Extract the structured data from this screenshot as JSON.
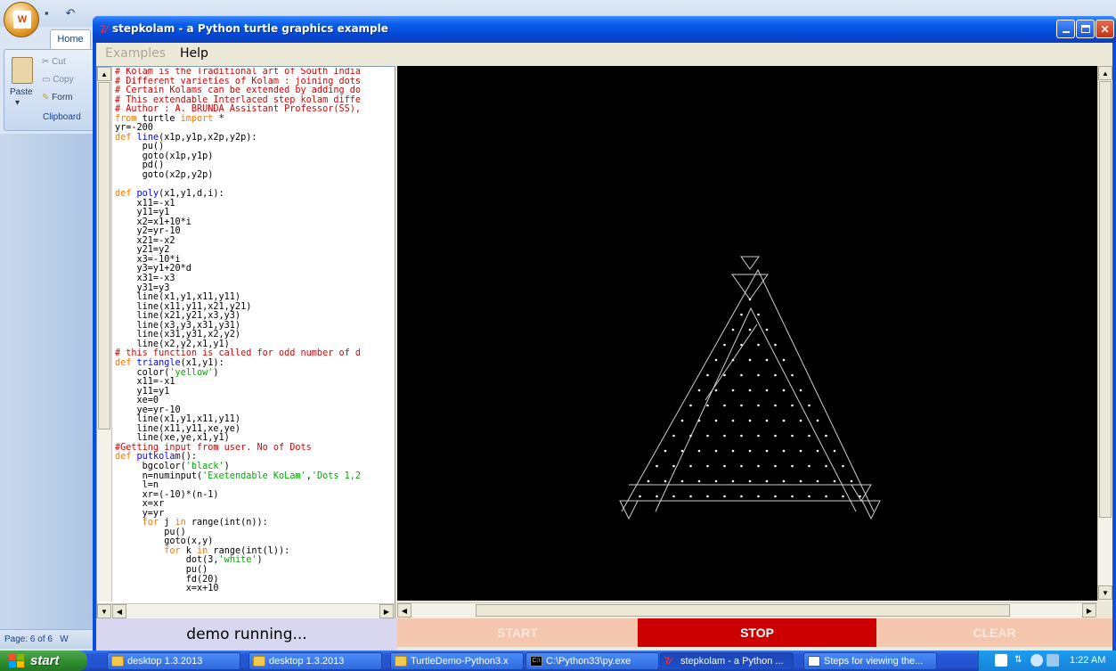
{
  "word": {
    "home_tab": "Home",
    "cut": "Cut",
    "copy": "Copy",
    "format": "Form",
    "paste": "Paste",
    "clipboard": "Clipboard",
    "status": "Page: 6 of 6",
    "status_cut": "W"
  },
  "window": {
    "title": "stepkolam - a Python turtle graphics example"
  },
  "menu": {
    "examples": "Examples",
    "help": "Help"
  },
  "code_lines": [
    [
      [
        "c-com",
        "# Kolam is the Traditional art of South India"
      ]
    ],
    [
      [
        "c-com",
        "# Different varieties of Kolam : joining dots"
      ]
    ],
    [
      [
        "c-com",
        "# Certain Kolams can be extended by adding do"
      ]
    ],
    [
      [
        "c-com",
        "# This extendable Interlaced step kolam diffe"
      ]
    ],
    [
      [
        "c-com",
        "# Author : A. BRUNDA Assistant Professor(SS),"
      ]
    ],
    [
      [
        "c-kw",
        "from"
      ],
      [
        "c-txt",
        " turtle "
      ],
      [
        "c-kw",
        "import"
      ],
      [
        "c-txt",
        " *"
      ]
    ],
    [
      [
        "c-txt",
        "yr=-200"
      ]
    ],
    [
      [
        "c-kw",
        "def"
      ],
      [
        "c-txt",
        " "
      ],
      [
        "c-def",
        "line"
      ],
      [
        "c-txt",
        "(x1p,y1p,x2p,y2p):"
      ]
    ],
    [
      [
        "c-txt",
        "     pu()"
      ]
    ],
    [
      [
        "c-txt",
        "     goto(x1p,y1p)"
      ]
    ],
    [
      [
        "c-txt",
        "     pd()"
      ]
    ],
    [
      [
        "c-txt",
        "     goto(x2p,y2p)"
      ]
    ],
    [
      [
        "c-txt",
        ""
      ]
    ],
    [
      [
        "c-kw",
        "def"
      ],
      [
        "c-txt",
        " "
      ],
      [
        "c-def",
        "poly"
      ],
      [
        "c-txt",
        "(x1,y1,d,i):"
      ]
    ],
    [
      [
        "c-txt",
        "    x11=-x1"
      ]
    ],
    [
      [
        "c-txt",
        "    y11=y1"
      ]
    ],
    [
      [
        "c-txt",
        "    x2=x1+10*i"
      ]
    ],
    [
      [
        "c-txt",
        "    y2=yr-10"
      ]
    ],
    [
      [
        "c-txt",
        "    x21=-x2"
      ]
    ],
    [
      [
        "c-txt",
        "    y21=y2"
      ]
    ],
    [
      [
        "c-txt",
        "    x3=-10*i"
      ]
    ],
    [
      [
        "c-txt",
        "    y3=y1+20*d"
      ]
    ],
    [
      [
        "c-txt",
        "    x31=-x3"
      ]
    ],
    [
      [
        "c-txt",
        "    y31=y3"
      ]
    ],
    [
      [
        "c-txt",
        "    line(x1,y1,x11,y11)"
      ]
    ],
    [
      [
        "c-txt",
        "    line(x11,y11,x21,y21)"
      ]
    ],
    [
      [
        "c-txt",
        "    line(x21,y21,x3,y3)"
      ]
    ],
    [
      [
        "c-txt",
        "    line(x3,y3,x31,y31)"
      ]
    ],
    [
      [
        "c-txt",
        "    line(x31,y31,x2,y2)"
      ]
    ],
    [
      [
        "c-txt",
        "    line(x2,y2,x1,y1)"
      ]
    ],
    [
      [
        "c-com",
        "# this function is called for odd number of d"
      ]
    ],
    [
      [
        "c-kw",
        "def"
      ],
      [
        "c-txt",
        " "
      ],
      [
        "c-def",
        "triangle"
      ],
      [
        "c-txt",
        "(x1,y1):"
      ]
    ],
    [
      [
        "c-txt",
        "    color("
      ],
      [
        "c-str",
        "'yellow'"
      ],
      [
        "c-txt",
        ")"
      ]
    ],
    [
      [
        "c-txt",
        "    x11=-x1"
      ]
    ],
    [
      [
        "c-txt",
        "    y11=y1"
      ]
    ],
    [
      [
        "c-txt",
        "    xe=0"
      ]
    ],
    [
      [
        "c-txt",
        "    ye=yr-10"
      ]
    ],
    [
      [
        "c-txt",
        "    line(x1,y1,x11,y11)"
      ]
    ],
    [
      [
        "c-txt",
        "    line(x11,y11,xe,ye)"
      ]
    ],
    [
      [
        "c-txt",
        "    line(xe,ye,x1,y1)"
      ]
    ],
    [
      [
        "c-com",
        "#Getting input from user. No of Dots"
      ]
    ],
    [
      [
        "c-kw",
        "def"
      ],
      [
        "c-txt",
        " "
      ],
      [
        "c-def",
        "putkolam"
      ],
      [
        "c-txt",
        "():"
      ]
    ],
    [
      [
        "c-txt",
        "     bgcolor("
      ],
      [
        "c-str",
        "'black'"
      ],
      [
        "c-txt",
        ")"
      ]
    ],
    [
      [
        "c-txt",
        "     n=numinput("
      ],
      [
        "c-str",
        "'Exetendable KoLam'"
      ],
      [
        "c-txt",
        ","
      ],
      [
        "c-str",
        "'Dots 1,2"
      ]
    ],
    [
      [
        "c-txt",
        "     l=n"
      ]
    ],
    [
      [
        "c-txt",
        "     xr=(-10)*(n-1)"
      ]
    ],
    [
      [
        "c-txt",
        "     x=xr"
      ]
    ],
    [
      [
        "c-txt",
        "     y=yr"
      ]
    ],
    [
      [
        "c-txt",
        "     "
      ],
      [
        "c-kw",
        "for"
      ],
      [
        "c-txt",
        " j "
      ],
      [
        "c-kw",
        "in"
      ],
      [
        "c-txt",
        " range(int(n)):"
      ]
    ],
    [
      [
        "c-txt",
        "         pu()"
      ]
    ],
    [
      [
        "c-txt",
        "         goto(x,y)"
      ]
    ],
    [
      [
        "c-txt",
        "         "
      ],
      [
        "c-kw",
        "for"
      ],
      [
        "c-txt",
        " k "
      ],
      [
        "c-kw",
        "in"
      ],
      [
        "c-txt",
        " range(int(l)):"
      ]
    ],
    [
      [
        "c-txt",
        "             dot(3,"
      ],
      [
        "c-str",
        "'white'"
      ],
      [
        "c-txt",
        ")"
      ]
    ],
    [
      [
        "c-txt",
        "             pu()"
      ]
    ],
    [
      [
        "c-txt",
        "             fd(20)"
      ]
    ],
    [
      [
        "c-txt",
        "             x=x+10"
      ]
    ]
  ],
  "status": {
    "demo": "demo running..."
  },
  "buttons": {
    "start": "START",
    "stop": "STOP",
    "clear": "CLEAR"
  },
  "colors": {
    "stop_active": "#cc0000",
    "inactive_button": "#f4c6ae",
    "canvas_bg": "#000000"
  },
  "taskbar": {
    "start": "start",
    "tasks": [
      {
        "label": "desktop 1.3.2013",
        "icon": "folder-icon"
      },
      {
        "label": "desktop 1.3.2013",
        "icon": "folder-icon"
      },
      {
        "label": "TurtleDemo-Python3.x",
        "icon": "folder-icon"
      },
      {
        "label": "C:\\Python33\\py.exe",
        "icon": "cmd-icon"
      },
      {
        "label": "stepkolam - a Python ...",
        "icon": "tk-icon",
        "active": true
      },
      {
        "label": "Steps for viewing the...",
        "icon": "word-icon"
      }
    ],
    "clock": "1:22 AM"
  }
}
